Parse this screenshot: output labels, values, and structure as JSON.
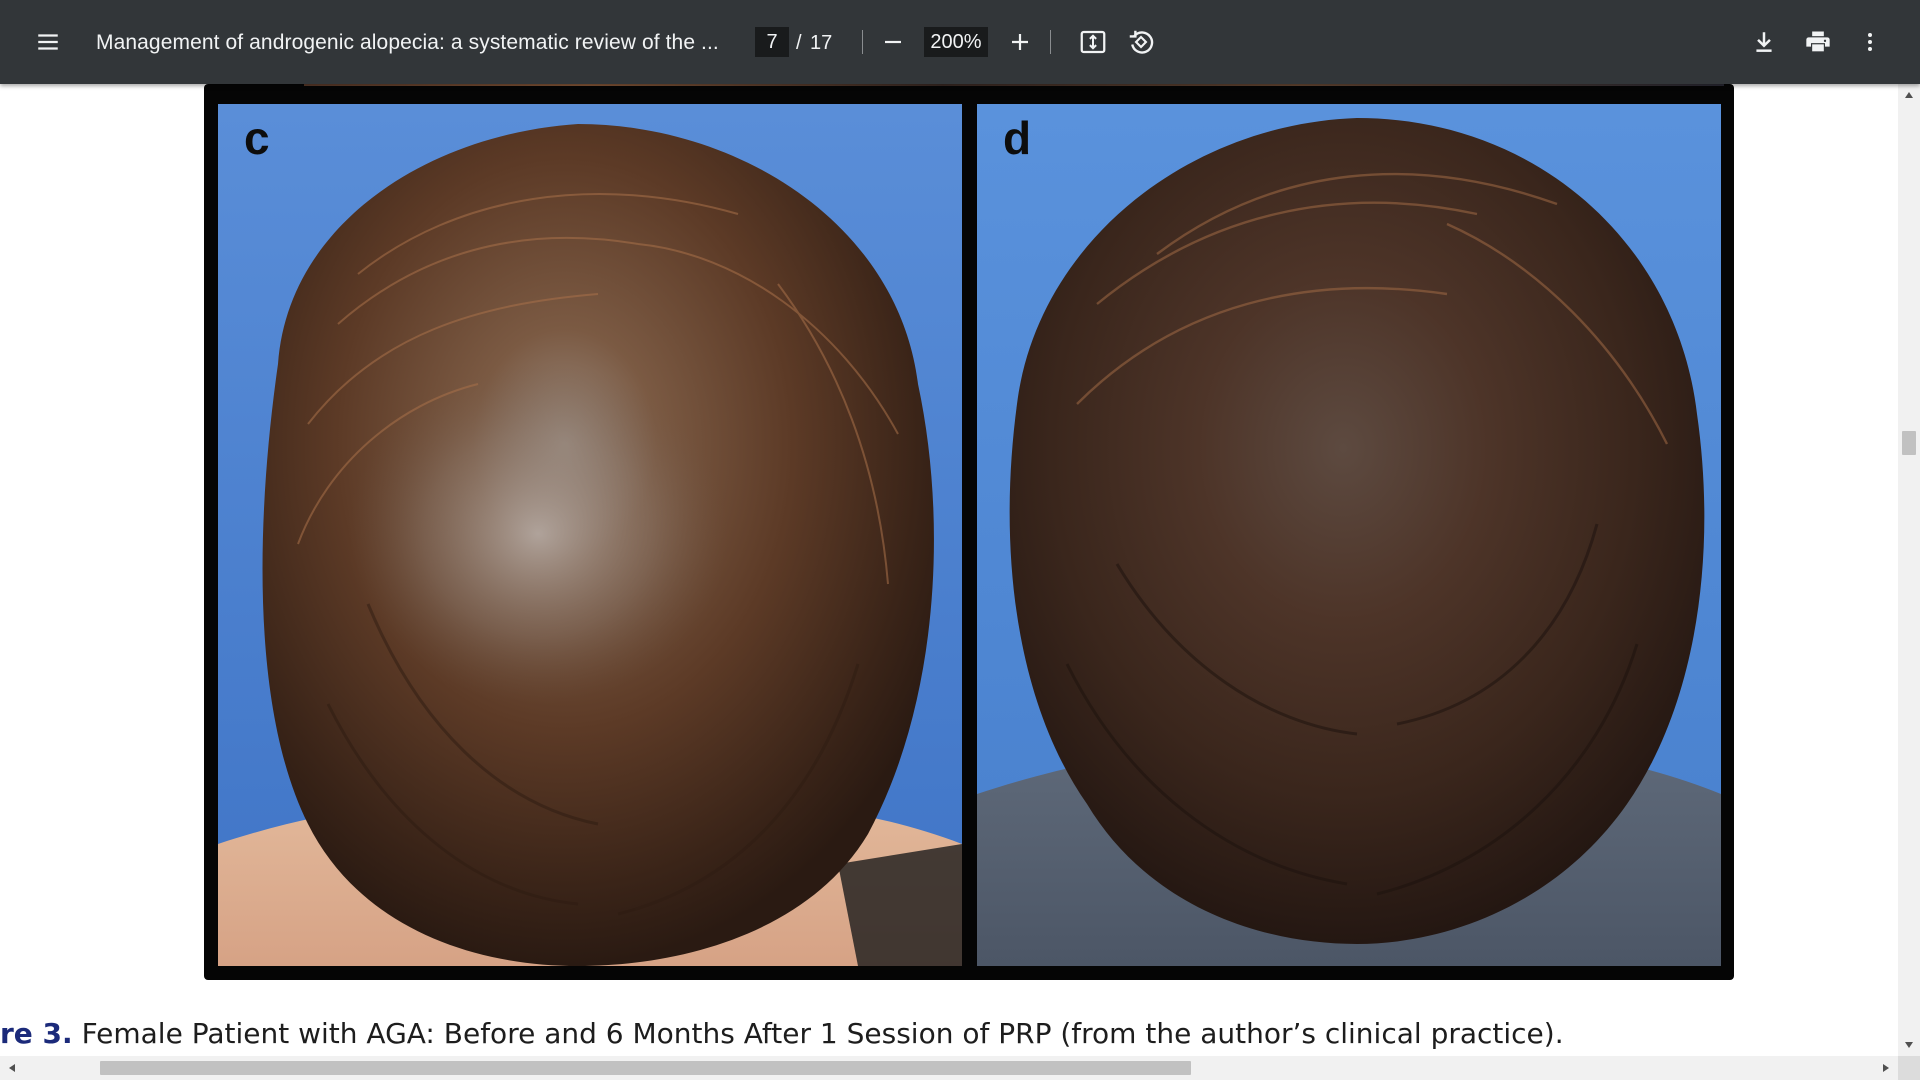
{
  "toolbar": {
    "menu_icon": "hamburger-menu-icon",
    "title": "Management of androgenic alopecia: a systematic review of the ...",
    "current_page": "7",
    "page_separator": "/",
    "total_pages": "17",
    "zoom_out_icon": "minus-icon",
    "zoom_value": "200%",
    "zoom_in_icon": "plus-icon",
    "fit_icon": "fit-to-page-icon",
    "rotate_icon": "rotate-counterclockwise-icon",
    "download_icon": "download-icon",
    "print_icon": "print-icon",
    "more_icon": "more-vert-icon"
  },
  "document": {
    "figure": {
      "panels": [
        {
          "label": "c"
        },
        {
          "label": "d"
        }
      ]
    },
    "caption": {
      "label": "re 3.",
      "text": " Female Patient with AGA: Before and 6 Months After 1 Session of PRP (from the author’s clinical practice)."
    }
  },
  "scrollbars": {
    "vertical_position": 0.36,
    "vertical_visible_fraction": 0.02,
    "horizontal_position": 0.1,
    "horizontal_visible_fraction": 0.59
  },
  "colors": {
    "toolbar_bg": "#323639",
    "input_bg": "#191b1c",
    "caption_label": "#1b2a7a",
    "photo_background": "#4a80cf"
  }
}
